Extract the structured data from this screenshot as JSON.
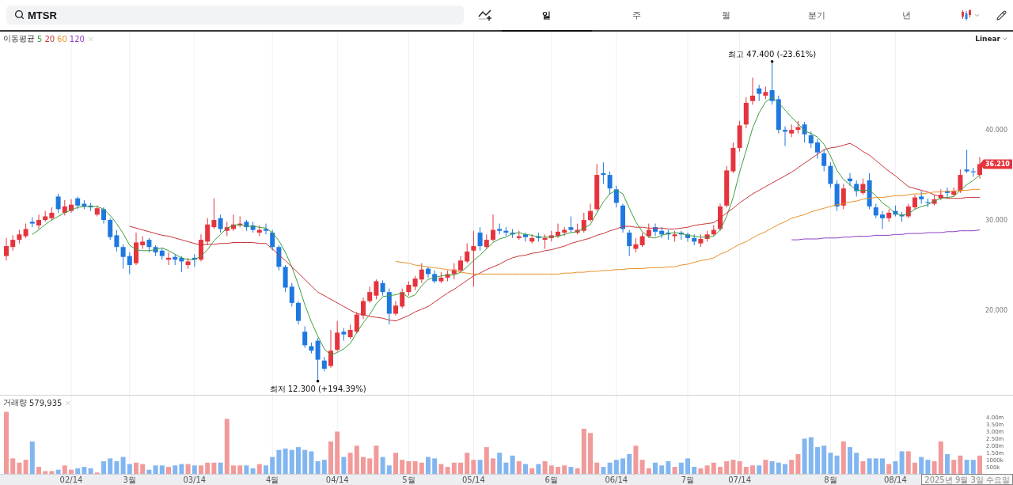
{
  "search": {
    "value": "MTSR"
  },
  "tabs": [
    {
      "label": "일",
      "selected": true
    },
    {
      "label": "주",
      "selected": false
    },
    {
      "label": "월",
      "selected": false
    },
    {
      "label": "분기",
      "selected": false
    },
    {
      "label": "년",
      "selected": false
    }
  ],
  "price_chart": {
    "legend_label": "이동평균",
    "scale": "Linear",
    "last_price": "36.210",
    "high_label": "최고 47.400 (-23.61%)",
    "low_label": "최저 12.300 (+194.39%)",
    "chart_data": {
      "type": "candlestick",
      "ohlc": [
        [
          26.0,
          28.0,
          25.5,
          27.1
        ],
        [
          27.0,
          28.3,
          26.6,
          27.8
        ],
        [
          27.8,
          28.9,
          27.4,
          28.4
        ],
        [
          28.2,
          29.6,
          28.0,
          29.0
        ],
        [
          29.8,
          30.3,
          29.2,
          29.6
        ],
        [
          29.4,
          30.6,
          29.0,
          30.0
        ],
        [
          30.0,
          31.0,
          29.8,
          30.4
        ],
        [
          30.2,
          31.4,
          30.0,
          30.8
        ],
        [
          32.6,
          32.9,
          30.8,
          31.2
        ],
        [
          30.8,
          32.2,
          30.5,
          31.5
        ],
        [
          31.0,
          32.3,
          30.8,
          31.7
        ],
        [
          32.4,
          32.6,
          31.2,
          31.6
        ],
        [
          31.8,
          32.2,
          31.2,
          31.5
        ],
        [
          31.6,
          31.9,
          31.0,
          31.4
        ],
        [
          30.6,
          31.6,
          30.4,
          31.3
        ],
        [
          31.2,
          31.4,
          29.6,
          30.0
        ],
        [
          30.0,
          30.2,
          27.8,
          28.1
        ],
        [
          28.3,
          28.9,
          26.5,
          27.0
        ],
        [
          27.0,
          27.3,
          24.6,
          25.9
        ],
        [
          26.0,
          26.4,
          24.0,
          25.0
        ],
        [
          25.2,
          28.6,
          25.0,
          27.5
        ],
        [
          27.2,
          28.2,
          26.8,
          27.6
        ],
        [
          27.8,
          28.0,
          26.4,
          27.0
        ],
        [
          27.0,
          27.2,
          26.0,
          26.4
        ],
        [
          26.6,
          26.9,
          25.6,
          26.0
        ],
        [
          25.6,
          26.4,
          25.0,
          25.8
        ],
        [
          25.9,
          26.2,
          25.0,
          25.6
        ],
        [
          25.8,
          26.0,
          24.2,
          25.4
        ],
        [
          25.0,
          25.8,
          24.6,
          25.4
        ],
        [
          25.8,
          26.2,
          24.8,
          25.6
        ],
        [
          25.6,
          28.4,
          25.4,
          27.8
        ],
        [
          27.6,
          30.2,
          27.2,
          29.5
        ],
        [
          29.2,
          32.4,
          29.0,
          30.0
        ],
        [
          30.2,
          30.6,
          28.6,
          29.0
        ],
        [
          28.8,
          29.8,
          28.2,
          29.2
        ],
        [
          29.0,
          30.6,
          28.8,
          29.5
        ],
        [
          29.4,
          30.4,
          29.2,
          29.6
        ],
        [
          29.8,
          30.0,
          28.8,
          29.2
        ],
        [
          29.4,
          29.8,
          28.6,
          28.9
        ],
        [
          28.6,
          29.4,
          28.2,
          28.9
        ],
        [
          29.0,
          29.6,
          28.4,
          28.8
        ],
        [
          28.6,
          28.9,
          26.6,
          27.0
        ],
        [
          27.0,
          27.2,
          24.4,
          24.8
        ],
        [
          24.8,
          25.0,
          22.0,
          22.5
        ],
        [
          22.6,
          23.0,
          20.4,
          20.8
        ],
        [
          20.8,
          21.0,
          18.4,
          18.8
        ],
        [
          17.6,
          18.2,
          15.8,
          16.1
        ],
        [
          16.0,
          16.4,
          15.2,
          15.5
        ],
        [
          16.6,
          16.9,
          12.3,
          14.5
        ],
        [
          14.4,
          14.8,
          13.2,
          13.5
        ],
        [
          13.8,
          17.8,
          13.6,
          15.5
        ],
        [
          15.6,
          18.8,
          15.4,
          17.5
        ],
        [
          17.6,
          18.0,
          16.6,
          17.3
        ],
        [
          17.0,
          18.4,
          16.8,
          17.8
        ],
        [
          17.6,
          19.8,
          17.4,
          19.5
        ],
        [
          19.4,
          21.4,
          19.0,
          21.0
        ],
        [
          21.0,
          22.6,
          20.8,
          22.0
        ],
        [
          21.6,
          23.4,
          21.2,
          23.2
        ],
        [
          23.0,
          23.3,
          21.6,
          22.0
        ],
        [
          22.0,
          22.4,
          18.4,
          19.6
        ],
        [
          19.6,
          21.0,
          19.4,
          20.5
        ],
        [
          20.4,
          22.4,
          20.2,
          22.0
        ],
        [
          22.0,
          23.2,
          21.6,
          22.8
        ],
        [
          22.6,
          23.8,
          22.2,
          23.5
        ],
        [
          23.4,
          25.2,
          23.0,
          24.5
        ],
        [
          24.6,
          24.8,
          23.6,
          24.0
        ],
        [
          24.0,
          24.4,
          23.0,
          23.2
        ],
        [
          23.2,
          24.2,
          23.0,
          23.6
        ],
        [
          23.6,
          24.4,
          23.2,
          24.0
        ],
        [
          24.0,
          25.2,
          23.4,
          24.5
        ],
        [
          24.4,
          26.0,
          24.2,
          25.5
        ],
        [
          25.4,
          27.4,
          25.2,
          26.5
        ],
        [
          26.6,
          28.8,
          22.6,
          27.1
        ],
        [
          28.6,
          29.2,
          26.6,
          27.1
        ],
        [
          27.0,
          28.4,
          26.8,
          27.8
        ],
        [
          27.8,
          30.6,
          27.6,
          28.9
        ],
        [
          29.0,
          29.6,
          28.4,
          28.8
        ],
        [
          28.8,
          29.2,
          28.2,
          28.6
        ],
        [
          28.6,
          29.0,
          28.0,
          28.4
        ],
        [
          28.0,
          28.8,
          27.8,
          28.2
        ],
        [
          28.4,
          28.6,
          27.6,
          28.1
        ],
        [
          27.6,
          28.4,
          27.4,
          28.0
        ],
        [
          28.2,
          28.6,
          27.6,
          28.0
        ],
        [
          27.8,
          28.4,
          26.8,
          28.0
        ],
        [
          28.0,
          28.8,
          27.6,
          28.3
        ],
        [
          28.2,
          29.6,
          28.0,
          28.7
        ],
        [
          28.6,
          29.2,
          28.2,
          28.9
        ],
        [
          29.2,
          30.4,
          28.6,
          28.9
        ],
        [
          28.6,
          29.6,
          28.4,
          28.9
        ],
        [
          28.8,
          30.8,
          28.6,
          30.0
        ],
        [
          30.0,
          31.8,
          29.8,
          31.0
        ],
        [
          31.2,
          36.2,
          31.0,
          35.0
        ],
        [
          35.2,
          36.4,
          34.0,
          35.0
        ],
        [
          35.0,
          35.4,
          32.8,
          33.5
        ],
        [
          33.4,
          33.8,
          31.4,
          31.9
        ],
        [
          31.6,
          31.8,
          28.6,
          29.0
        ],
        [
          28.6,
          28.9,
          26.0,
          27.1
        ],
        [
          26.8,
          28.0,
          26.4,
          27.3
        ],
        [
          27.2,
          28.6,
          27.0,
          28.2
        ],
        [
          28.2,
          29.6,
          28.0,
          28.9
        ],
        [
          29.2,
          29.6,
          28.2,
          28.7
        ],
        [
          28.8,
          29.2,
          28.0,
          28.4
        ],
        [
          28.6,
          28.9,
          27.8,
          28.4
        ],
        [
          28.2,
          28.8,
          27.6,
          28.4
        ],
        [
          28.6,
          28.8,
          27.8,
          28.4
        ],
        [
          28.4,
          28.6,
          27.6,
          28.0
        ],
        [
          28.0,
          28.4,
          27.2,
          27.6
        ],
        [
          27.4,
          28.4,
          27.0,
          27.9
        ],
        [
          27.9,
          28.8,
          27.6,
          28.4
        ],
        [
          28.4,
          29.4,
          28.2,
          28.9
        ],
        [
          29.0,
          31.8,
          28.8,
          31.5
        ],
        [
          31.6,
          36.0,
          31.4,
          35.5
        ],
        [
          35.4,
          38.6,
          35.2,
          38.0
        ],
        [
          38.0,
          41.0,
          37.6,
          40.5
        ],
        [
          40.6,
          43.6,
          40.2,
          43.0
        ],
        [
          43.2,
          45.8,
          42.8,
          43.8
        ],
        [
          44.6,
          45.0,
          43.2,
          44.0
        ],
        [
          43.8,
          44.8,
          43.4,
          44.2
        ],
        [
          44.4,
          47.4,
          42.8,
          43.2
        ],
        [
          43.4,
          43.8,
          39.6,
          40.0
        ],
        [
          40.0,
          40.4,
          38.2,
          39.8
        ],
        [
          39.6,
          40.6,
          39.2,
          40.0
        ],
        [
          40.0,
          41.0,
          39.6,
          40.3
        ],
        [
          40.6,
          40.9,
          38.6,
          39.5
        ],
        [
          39.4,
          39.8,
          38.0,
          38.5
        ],
        [
          38.6,
          39.0,
          36.8,
          37.5
        ],
        [
          37.4,
          37.8,
          35.4,
          36.0
        ],
        [
          36.0,
          36.4,
          33.6,
          34.0
        ],
        [
          34.0,
          34.4,
          31.0,
          31.5
        ],
        [
          31.6,
          34.0,
          31.2,
          33.5
        ],
        [
          34.6,
          35.2,
          33.8,
          34.3
        ],
        [
          34.0,
          34.4,
          32.6,
          33.2
        ],
        [
          33.0,
          34.6,
          32.8,
          34.0
        ],
        [
          34.4,
          35.2,
          31.2,
          31.5
        ],
        [
          31.4,
          31.8,
          30.2,
          30.5
        ],
        [
          30.6,
          31.0,
          29.0,
          30.2
        ],
        [
          30.2,
          31.2,
          29.8,
          30.8
        ],
        [
          31.0,
          31.6,
          30.4,
          30.6
        ],
        [
          30.6,
          30.9,
          29.8,
          30.4
        ],
        [
          30.4,
          31.8,
          30.2,
          31.5
        ],
        [
          31.4,
          32.8,
          31.2,
          32.5
        ],
        [
          32.6,
          33.2,
          31.8,
          32.3
        ],
        [
          32.0,
          32.4,
          31.4,
          31.9
        ],
        [
          31.8,
          32.8,
          31.6,
          32.3
        ],
        [
          32.4,
          33.4,
          32.2,
          32.8
        ],
        [
          33.2,
          33.6,
          32.4,
          33.0
        ],
        [
          32.8,
          33.6,
          32.6,
          33.2
        ],
        [
          33.2,
          35.6,
          33.0,
          35.0
        ],
        [
          35.6,
          37.8,
          35.2,
          35.4
        ],
        [
          35.4,
          35.8,
          34.8,
          35.3
        ],
        [
          35.0,
          37.0,
          34.6,
          36.2
        ]
      ],
      "ylim": [
        10.6,
        50.9
      ],
      "categories": [
        null,
        null,
        null,
        null,
        null,
        null,
        null,
        null,
        null,
        null,
        null,
        null,
        null,
        null,
        null,
        null,
        null,
        null,
        null,
        null,
        null,
        null,
        null,
        null,
        null,
        null,
        null,
        null,
        null,
        null,
        null,
        null,
        null,
        null,
        null,
        null,
        null,
        null,
        null,
        null,
        null,
        null,
        null,
        null,
        null,
        null,
        null,
        null,
        null,
        null,
        null,
        null,
        null,
        null,
        null,
        null,
        null,
        null,
        null,
        null,
        null,
        null,
        null,
        null,
        null,
        null,
        null,
        null,
        null,
        null,
        null,
        null,
        null,
        null,
        null,
        null,
        null,
        null,
        null,
        null,
        null,
        null,
        null,
        null,
        null,
        null,
        null,
        null,
        null,
        null,
        null,
        null,
        null,
        null,
        null,
        null,
        null,
        null,
        null,
        null,
        null,
        null,
        null,
        null,
        null,
        null,
        null,
        null,
        null,
        null,
        null,
        null,
        null,
        null,
        null,
        null,
        null,
        null,
        null,
        null,
        null,
        null,
        null,
        null,
        null,
        null,
        null,
        null,
        null,
        null,
        null,
        null,
        null,
        null,
        null,
        null,
        null,
        null,
        null,
        null,
        null,
        null,
        null,
        null,
        null,
        null,
        null,
        null,
        null,
        null,
        null
      ],
      "yticks": [
        {
          "value": 20,
          "label": "20.000"
        },
        {
          "value": 30,
          "label": "30.000"
        },
        {
          "value": 40,
          "label": "40.000"
        }
      ],
      "series": [
        {
          "name": "5",
          "type": "line",
          "color": "#3d9e3d",
          "values": [
            null,
            null,
            null,
            null,
            28.4,
            28.9,
            29.5,
            30.0,
            30.4,
            30.8,
            31.1,
            31.4,
            31.5,
            31.5,
            31.5,
            31.2,
            30.5,
            29.6,
            28.5,
            27.2,
            26.7,
            26.6,
            26.6,
            26.7,
            26.9,
            26.6,
            26.2,
            25.8,
            25.6,
            25.6,
            26.0,
            26.7,
            27.7,
            28.4,
            29.1,
            29.4,
            29.5,
            29.3,
            29.3,
            29.2,
            29.1,
            28.6,
            27.7,
            26.4,
            24.8,
            22.8,
            20.6,
            18.7,
            17.1,
            15.7,
            15.0,
            15.3,
            15.7,
            16.3,
            17.5,
            18.6,
            19.5,
            20.7,
            21.5,
            21.6,
            21.7,
            21.9,
            21.4,
            21.7,
            22.7,
            23.4,
            23.6,
            23.8,
            23.9,
            23.9,
            24.2,
            24.8,
            25.5,
            26.1,
            26.8,
            27.5,
            27.9,
            28.1,
            28.5,
            28.6,
            28.4,
            28.3,
            28.1,
            28.1,
            28.1,
            28.2,
            28.4,
            28.6,
            28.7,
            29.1,
            29.5,
            30.8,
            32.0,
            32.9,
            33.3,
            32.9,
            31.3,
            29.8,
            28.7,
            28.1,
            28.0,
            28.3,
            28.5,
            28.6,
            28.5,
            28.3,
            28.2,
            28.1,
            28.1,
            28.2,
            28.9,
            30.4,
            32.5,
            35.3,
            37.7,
            40.2,
            41.9,
            43.1,
            43.6,
            43.0,
            42.2,
            41.4,
            40.7,
            39.9,
            39.6,
            39.2,
            38.4,
            37.1,
            35.5,
            34.5,
            33.9,
            33.3,
            33.3,
            33.3,
            32.7,
            31.9,
            31.4,
            30.7,
            30.5,
            30.7,
            31.2,
            31.5,
            31.7,
            32.1,
            32.4,
            32.5,
            32.6,
            33.3,
            33.9,
            34.4,
            35.0
          ]
        },
        {
          "name": "20",
          "type": "line",
          "color": "#c8343a",
          "values": [
            null,
            null,
            null,
            null,
            null,
            null,
            null,
            null,
            null,
            null,
            null,
            null,
            null,
            null,
            null,
            null,
            null,
            null,
            null,
            29.3,
            29.1,
            28.9,
            28.7,
            28.5,
            28.3,
            28.2,
            28.0,
            27.8,
            27.6,
            27.4,
            27.2,
            27.3,
            27.3,
            27.4,
            27.4,
            27.5,
            27.5,
            27.5,
            27.5,
            27.4,
            27.4,
            26.8,
            26.1,
            25.5,
            24.8,
            24.1,
            23.4,
            22.7,
            22.0,
            21.6,
            21.2,
            20.8,
            20.4,
            20.0,
            19.6,
            19.5,
            19.3,
            19.2,
            19.1,
            18.9,
            18.8,
            19.1,
            19.4,
            19.8,
            20.1,
            20.4,
            20.9,
            21.4,
            21.9,
            22.3,
            22.8,
            23.3,
            23.8,
            24.1,
            24.5,
            24.8,
            25.1,
            25.5,
            25.8,
            26.0,
            26.1,
            26.3,
            26.4,
            26.6,
            26.7,
            26.9,
            27.1,
            27.4,
            27.6,
            27.8,
            28.0,
            28.3,
            28.5,
            28.8,
            29.0,
            29.3,
            29.3,
            29.2,
            29.2,
            29.1,
            29.1,
            29.1,
            29.0,
            29.0,
            29.1,
            29.2,
            29.4,
            29.5,
            29.6,
            29.7,
            30.2,
            30.8,
            31.3,
            31.9,
            32.4,
            32.9,
            33.3,
            33.7,
            34.1,
            34.5,
            34.9,
            35.3,
            35.8,
            36.3,
            36.8,
            37.3,
            37.8,
            38.0,
            38.1,
            38.3,
            38.5,
            38.1,
            37.6,
            37.2,
            36.6,
            36.0,
            35.4,
            34.9,
            34.3,
            33.7,
            33.5,
            33.3,
            33.1,
            32.8,
            32.6,
            32.4,
            32.4,
            32.4,
            32.5,
            32.5,
            32.5
          ]
        },
        {
          "name": "60",
          "type": "line",
          "color": "#e8902a",
          "values": [
            null,
            null,
            null,
            null,
            null,
            null,
            null,
            null,
            null,
            null,
            null,
            null,
            null,
            null,
            null,
            null,
            null,
            null,
            null,
            null,
            null,
            null,
            null,
            null,
            null,
            null,
            null,
            null,
            null,
            null,
            null,
            null,
            null,
            null,
            null,
            null,
            null,
            null,
            null,
            null,
            null,
            null,
            null,
            null,
            null,
            null,
            null,
            null,
            null,
            null,
            null,
            null,
            null,
            null,
            null,
            null,
            null,
            null,
            null,
            null,
            25.4,
            25.3,
            25.2,
            25.0,
            24.9,
            24.8,
            24.7,
            24.6,
            24.5,
            24.4,
            24.2,
            24.1,
            24.0,
            24.0,
            24.0,
            24.0,
            24.0,
            24.0,
            24.0,
            24.0,
            24.0,
            24.0,
            24.0,
            24.0,
            24.0,
            24.0,
            24.1,
            24.1,
            24.2,
            24.2,
            24.3,
            24.3,
            24.4,
            24.4,
            24.5,
            24.5,
            24.6,
            24.6,
            24.6,
            24.7,
            24.7,
            24.7,
            24.8,
            24.8,
            25.0,
            25.1,
            25.3,
            25.5,
            25.6,
            25.8,
            26.2,
            26.5,
            26.9,
            27.3,
            27.6,
            28.0,
            28.4,
            28.7,
            29.1,
            29.5,
            29.8,
            30.2,
            30.4,
            30.6,
            30.9,
            31.1,
            31.3,
            31.5,
            31.7,
            31.8,
            32.0,
            32.1,
            32.3,
            32.4,
            32.5,
            32.5,
            32.6,
            32.7,
            32.7,
            32.8,
            32.9,
            32.9,
            33.0,
            33.1,
            33.1,
            33.2,
            33.2,
            33.3,
            33.3,
            33.4,
            33.4
          ]
        },
        {
          "name": "120",
          "type": "line",
          "color": "#8a3fc4",
          "values": [
            null,
            null,
            null,
            null,
            null,
            null,
            null,
            null,
            null,
            null,
            null,
            null,
            null,
            null,
            null,
            null,
            null,
            null,
            null,
            null,
            null,
            null,
            null,
            null,
            null,
            null,
            null,
            null,
            null,
            null,
            null,
            null,
            null,
            null,
            null,
            null,
            null,
            null,
            null,
            null,
            null,
            null,
            null,
            null,
            null,
            null,
            null,
            null,
            null,
            null,
            null,
            null,
            null,
            null,
            null,
            null,
            null,
            null,
            null,
            null,
            null,
            null,
            null,
            null,
            null,
            null,
            null,
            null,
            null,
            null,
            null,
            null,
            null,
            null,
            null,
            null,
            null,
            null,
            null,
            null,
            null,
            null,
            null,
            null,
            null,
            null,
            null,
            null,
            null,
            null,
            null,
            null,
            null,
            null,
            null,
            null,
            null,
            null,
            null,
            null,
            null,
            null,
            null,
            null,
            null,
            null,
            null,
            null,
            null,
            null,
            null,
            null,
            null,
            null,
            null,
            null,
            null,
            null,
            null,
            null,
            null,
            27.8,
            27.8,
            27.9,
            27.9,
            27.9,
            28.0,
            28.0,
            28.0,
            28.1,
            28.1,
            28.2,
            28.2,
            28.2,
            28.3,
            28.3,
            28.3,
            28.4,
            28.4,
            28.5,
            28.5,
            28.5,
            28.6,
            28.6,
            28.6,
            28.7,
            28.7,
            28.8,
            28.8,
            28.8,
            28.9
          ]
        }
      ]
    }
  },
  "volume_chart": {
    "legend_label": "거래량",
    "legend_value": "579,935",
    "chart_data": {
      "type": "bar",
      "ylim": [
        0,
        5550000
      ],
      "categories": [
        null,
        null,
        null,
        null,
        null,
        null,
        null,
        null,
        null,
        null,
        "02/14",
        null,
        null,
        null,
        null,
        null,
        null,
        null,
        null,
        "3월",
        null,
        null,
        null,
        null,
        null,
        null,
        null,
        null,
        null,
        "03/14",
        null,
        null,
        null,
        null,
        null,
        null,
        null,
        null,
        null,
        null,
        null,
        "4월",
        null,
        null,
        null,
        null,
        null,
        null,
        null,
        null,
        null,
        "04/14",
        null,
        null,
        null,
        null,
        null,
        null,
        null,
        null,
        null,
        null,
        "5월",
        null,
        null,
        null,
        null,
        null,
        null,
        null,
        null,
        null,
        "05/14",
        null,
        null,
        null,
        null,
        null,
        null,
        null,
        null,
        null,
        null,
        null,
        "6월",
        null,
        null,
        null,
        null,
        null,
        null,
        null,
        null,
        null,
        "06/14",
        null,
        null,
        null,
        null,
        null,
        null,
        null,
        null,
        null,
        null,
        "7월",
        null,
        null,
        null,
        null,
        null,
        null,
        null,
        "07/14",
        null,
        null,
        null,
        null,
        null,
        null,
        null,
        null,
        null,
        null,
        null,
        null,
        null,
        "8월",
        null,
        null,
        null,
        null,
        null,
        null,
        null,
        null,
        null,
        "08/14",
        null,
        null,
        null,
        null,
        null,
        null,
        null,
        null,
        null,
        null,
        null,
        null,
        null
      ],
      "yticks": [
        {
          "value": 500000,
          "label": "500k"
        },
        {
          "value": 1000000,
          "label": "1000k"
        },
        {
          "value": 1500000,
          "label": "1.50m"
        },
        {
          "value": 2000000,
          "label": "2.00m"
        },
        {
          "value": 2500000,
          "label": "2.50m"
        },
        {
          "value": 3000000,
          "label": "3.00m"
        },
        {
          "value": 3500000,
          "label": "3.50m"
        },
        {
          "value": 4000000,
          "label": "4.00m"
        }
      ],
      "values": [
        4400000,
        1100000,
        800000,
        1000000,
        2300000,
        500000,
        200000,
        200000,
        300000,
        600000,
        300000,
        400000,
        500000,
        400000,
        100000,
        900000,
        1100000,
        900000,
        1200000,
        700000,
        800000,
        700000,
        300000,
        600000,
        600000,
        500000,
        600000,
        700000,
        700000,
        600000,
        600000,
        800000,
        800000,
        800000,
        3900000,
        600000,
        600000,
        600000,
        400000,
        700000,
        600000,
        1200000,
        1700000,
        1800000,
        1700000,
        1900000,
        1700000,
        1600000,
        900000,
        1000000,
        2300000,
        3000000,
        1200000,
        1500000,
        2000000,
        1200000,
        1100000,
        2000000,
        1200000,
        600000,
        1500000,
        1000000,
        900000,
        900000,
        800000,
        1200000,
        1100000,
        700000,
        500000,
        800000,
        800000,
        1500000,
        1000000,
        1000000,
        1900000,
        1100000,
        1500000,
        800000,
        1300000,
        900000,
        700000,
        400000,
        700000,
        900000,
        600000,
        500000,
        600000,
        500000,
        400000,
        3200000,
        2900000,
        800000,
        500000,
        800000,
        1000000,
        1100000,
        1400000,
        2000000,
        1000000,
        400000,
        800000,
        600000,
        900000,
        500000,
        800000,
        1100000,
        500000,
        400000,
        600000,
        800000,
        500000,
        900000,
        1000000,
        900000,
        500000,
        600000,
        600000,
        1000000,
        900000,
        800000,
        700000,
        1000000,
        1400000,
        2500000,
        2600000,
        1900000,
        2000000,
        1500000,
        1300000,
        2300000,
        1900000,
        1500000,
        900000,
        1100000,
        1100000,
        1100000,
        700000,
        900000,
        1600000,
        1600000,
        800000,
        1200000,
        1000000,
        900000,
        2300000,
        1400000,
        1000000,
        1300000,
        1000000,
        1000000,
        1300000
      ]
    }
  },
  "date_label": "2025년 9월 3일 수요일"
}
